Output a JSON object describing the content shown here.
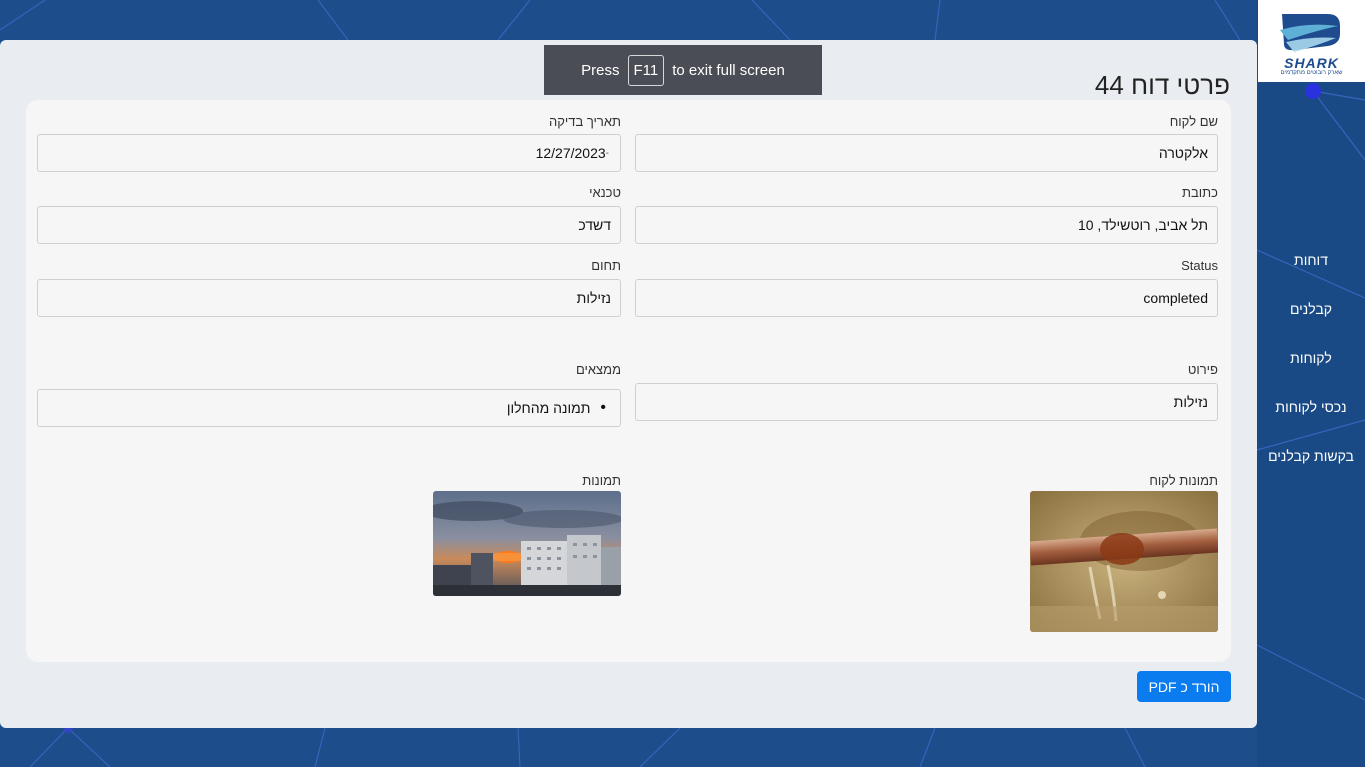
{
  "fullscreen_toast": {
    "press": "Press",
    "key": "F11",
    "rest": "to exit full screen"
  },
  "logo": {
    "brand": "SHARK",
    "tagline": "שארק רובוטים מתקדמים"
  },
  "nav": {
    "items": [
      {
        "label": "דוחות"
      },
      {
        "label": "קבלנים"
      },
      {
        "label": "לקוחות"
      },
      {
        "label": "נכסי לקוחות"
      },
      {
        "label": "בקשות קבלנים"
      }
    ]
  },
  "page": {
    "title": "פרטי דוח 44"
  },
  "fields": {
    "customer_name": {
      "label": "שם לקוח",
      "value": "אלקטרה"
    },
    "inspection_date": {
      "label": "תאריך בדיקה",
      "value": "12/27/2023"
    },
    "address": {
      "label": "כתובת",
      "value": "תל אביב, רוטשילד, 10"
    },
    "technician": {
      "label": "טכנאי",
      "value": "דשדכ"
    },
    "status": {
      "label": "Status",
      "value": "completed"
    },
    "domain": {
      "label": "תחום",
      "value": "נזילות"
    },
    "details": {
      "label": "פירוט",
      "value": "נזילות"
    },
    "findings": {
      "label": "ממצאים",
      "items": [
        "תמונה מהחלון"
      ]
    }
  },
  "images": {
    "customer_label": "תמונות לקוח",
    "report_label": "תמונות"
  },
  "actions": {
    "pdf_label": "הורד כ PDF"
  },
  "colors": {
    "page_bg": "#1d4d8a",
    "accent": "#0b7cf0",
    "toast_bg": "#4a4d55"
  }
}
